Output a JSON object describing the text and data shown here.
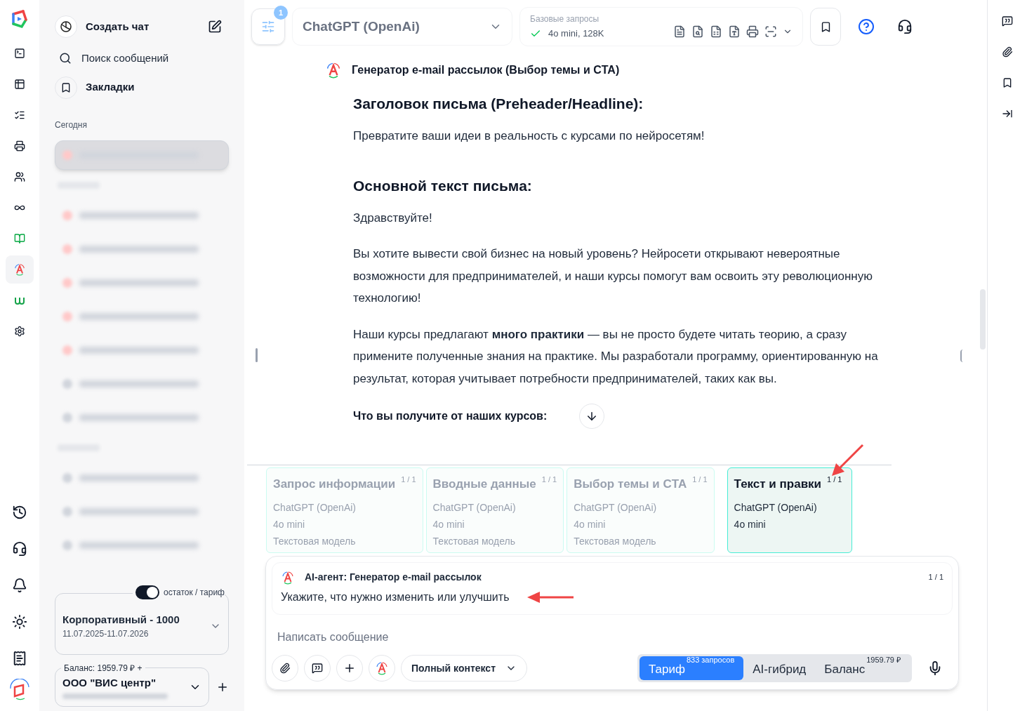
{
  "rail": {
    "items": [
      {
        "kind": "terminal",
        "selected": false
      },
      {
        "kind": "table",
        "selected": false
      },
      {
        "kind": "list",
        "selected": false
      },
      {
        "kind": "printer",
        "selected": false
      },
      {
        "kind": "users",
        "selected": false
      },
      {
        "kind": "infinity",
        "selected": false
      },
      {
        "kind": "books",
        "selected": false
      },
      {
        "kind": "agent",
        "selected": true
      },
      {
        "kind": "w",
        "selected": false
      },
      {
        "kind": "settings",
        "selected": false
      }
    ]
  },
  "sidebar": {
    "create": "Создать чат",
    "search": "Поиск сообщений",
    "bookmarks": "Закладки",
    "section": "Сегодня",
    "blurred": [
      {
        "kind": "item",
        "selected": true
      },
      {
        "kind": "heading"
      },
      {
        "kind": "item",
        "selected": false
      },
      {
        "kind": "item",
        "selected": false
      },
      {
        "kind": "item",
        "selected": false
      },
      {
        "kind": "item",
        "selected": false
      },
      {
        "kind": "item",
        "selected": false
      },
      {
        "kind": "item",
        "selected": false
      },
      {
        "kind": "item",
        "selected": false
      },
      {
        "kind": "heading"
      },
      {
        "kind": "item",
        "selected": false
      },
      {
        "kind": "item",
        "selected": false
      },
      {
        "kind": "item",
        "selected": false
      }
    ],
    "toggle": {
      "label": "остаток / тариф",
      "on": true
    },
    "plan": {
      "name": "Корпоративный - 1000",
      "dates": "11.07.2025-11.07.2026"
    },
    "balance": {
      "label": "Баланс: 1959.79 ₽ +",
      "org": "ООО \"ВИС центр\""
    }
  },
  "header": {
    "badge": "1",
    "model": "ChatGPT (OpenAi)",
    "requests": {
      "label": "Базовые запросы",
      "value": "4o mini, 128K"
    }
  },
  "message": {
    "agent": "Генератор e-mail рассылок (Выбор темы и CTA)",
    "blocks": [
      {
        "kind": "heading",
        "text": "Заголовок письма (Preheader/Headline):"
      },
      {
        "kind": "paragraph",
        "text": "Превратите ваши идеи в реальность с курсами по нейросетям!"
      },
      {
        "kind": "heading",
        "text": "Основной текст письма:"
      },
      {
        "kind": "paragraph",
        "text": "Здравствуйте!"
      },
      {
        "kind": "paragraph",
        "text": "Вы хотите вывести свой бизнес на новый уровень? Нейросети открывают невероятные возможности для предпринимателей, и наши курсы помогут вам освоить эту революционную технологию!"
      },
      {
        "kind": "paragraph",
        "text": "Наши курсы предлагают **много практики** — вы не просто будете читать теорию, а сразу примените полученные знания на практике. Мы разработали программу, ориентированную на результат, которая учитывает потребности предпринимателей, таких как вы."
      },
      {
        "kind": "subheading",
        "text": "Что вы получите от наших курсов:"
      }
    ]
  },
  "steps": [
    {
      "title": "Запрос информации",
      "counter": "1 / 1",
      "lines": [
        "ChatGPT (OpenAi)",
        "4o mini",
        "Текстовая модель"
      ],
      "selected": false
    },
    {
      "title": "Вводные данные",
      "counter": "1 / 1",
      "lines": [
        "ChatGPT (OpenAi)",
        "4o mini",
        "Текстовая модель"
      ],
      "selected": false
    },
    {
      "title": "Выбор темы и CTA",
      "counter": "1 / 1",
      "lines": [
        "ChatGPT (OpenAi)",
        "4o mini",
        "Текстовая модель"
      ],
      "selected": false
    },
    {
      "title": "Текст и правки",
      "counter": "1 / 1",
      "lines": [
        "ChatGPT (OpenAi)",
        "4o mini"
      ],
      "selected": true
    }
  ],
  "composer": {
    "agent": "AI-агент: Генератор e-mail рассылок",
    "counter": "1 / 1",
    "prompt": "Укажите, что нужно изменить или улучшить",
    "placeholder": "Написать сообщение",
    "context": "Полный контекст",
    "modes": [
      {
        "label": "Тариф",
        "sup": "833 запросов",
        "selected": true
      },
      {
        "label": "AI-гибрид",
        "selected": false
      },
      {
        "label": "Баланс",
        "sup": "1959.79 ₽",
        "selected": false
      }
    ]
  }
}
